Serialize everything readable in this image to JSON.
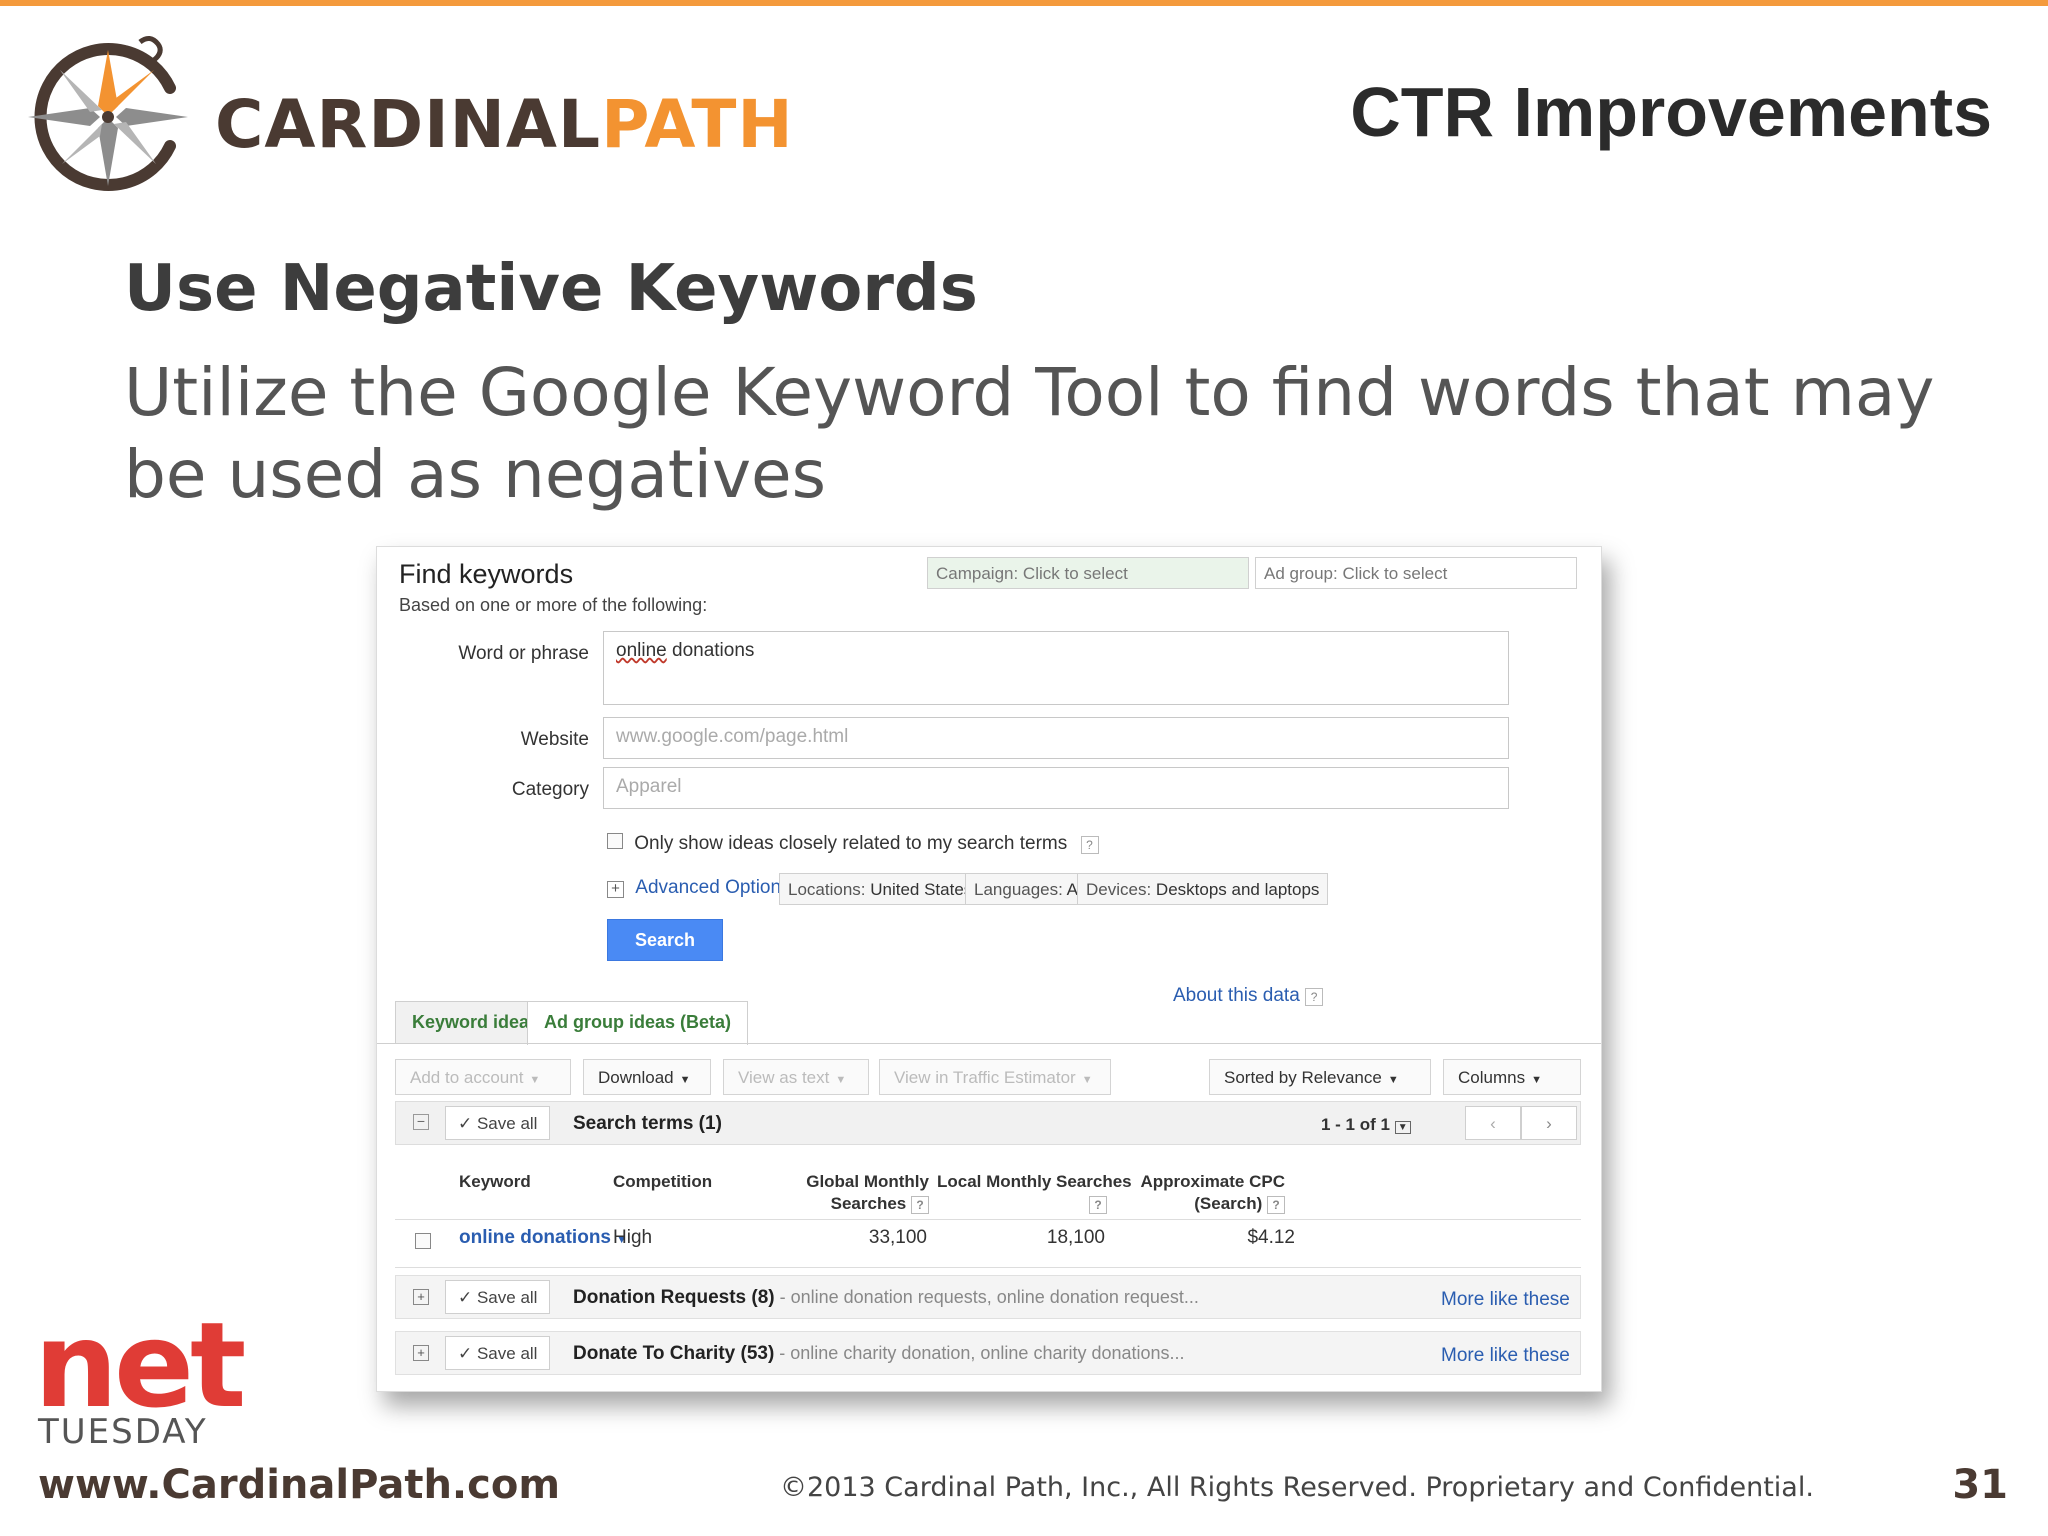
{
  "slide": {
    "brand_part1": "CARDINAL",
    "brand_part2": "PATH",
    "title": "CTR Improvements",
    "heading": "Use Negative Keywords",
    "subtext": "Utilize the Google Keyword Tool to find words that may be used as negatives",
    "footer_net": "net",
    "footer_tuesday": "TUESDAY",
    "footer_site": "www.CardinalPath.com",
    "footer_copyright": "©2013 Cardinal Path, Inc., All Rights Reserved. Proprietary and Confidential.",
    "page_number": "31"
  },
  "colors": {
    "accent_orange": "#f49a3c",
    "brand_brown": "#4a3a32",
    "net_red": "#e03c36",
    "link_blue": "#2a5db0",
    "search_button": "#4a8af4"
  },
  "tool": {
    "title": "Find keywords",
    "subtitle": "Based on one or more of the following:",
    "campaign_select": "Campaign: Click to select",
    "adgroup_select": "Ad group: Click to select",
    "word_label": "Word or phrase",
    "word_value_underlined": "online",
    "word_value_rest": " donations",
    "website_label": "Website",
    "website_placeholder": "www.google.com/page.html",
    "category_label": "Category",
    "category_placeholder": "Apparel",
    "only_related_label": "Only show ideas closely related to my search terms",
    "help_glyph": "?",
    "advanced_label": "Advanced Options and Filters",
    "locations_chip_key": "Locations:",
    "locations_chip_value": "United States",
    "languages_chip_key": "Languages:",
    "languages_chip_value": "All",
    "devices_chip_key": "Devices:",
    "devices_chip_value": "Desktops and laptops",
    "search_button": "Search",
    "tab_keyword_ideas": "Keyword ideas",
    "tab_adgroup_ideas": "Ad group ideas (Beta)",
    "about_data": "About this data",
    "toolbar": {
      "add_to_account": "Add to account",
      "download": "Download",
      "view_as_text": "View as text",
      "view_traffic": "View in Traffic Estimator",
      "sorted": "Sorted by Relevance",
      "columns": "Columns"
    },
    "save_all": "Save all",
    "search_terms_label": "Search terms (1)",
    "pagination": "1 - 1 of 1",
    "columns": {
      "keyword": "Keyword",
      "competition": "Competition",
      "global_1": "Global Monthly",
      "global_2": "Searches",
      "local": "Local Monthly Searches",
      "cpc_1": "Approximate CPC",
      "cpc_2": "(Search)"
    },
    "row": {
      "keyword": "online donations",
      "competition": "High",
      "global": "33,100",
      "local": "18,100",
      "cpc": "$4.12"
    },
    "groups": [
      {
        "name": "Donation Requests (8)",
        "desc": " - online donation requests, online donation request...",
        "more": "More like these"
      },
      {
        "name": "Donate To Charity (53)",
        "desc": " - online charity donation, online charity donations...",
        "more": "More like these"
      }
    ]
  }
}
